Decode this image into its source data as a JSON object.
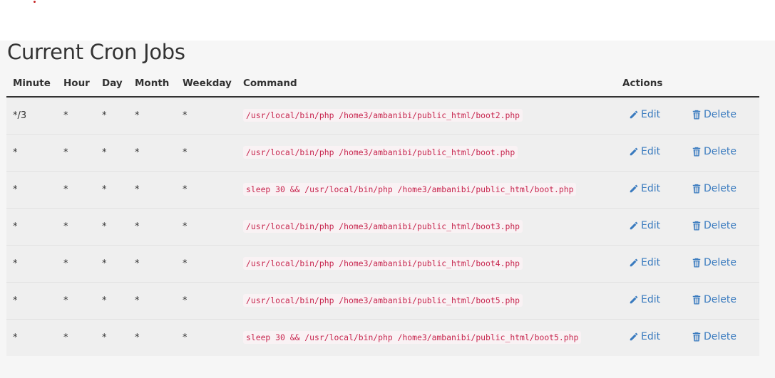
{
  "page": {
    "title": "Current Cron Jobs"
  },
  "table": {
    "headers": {
      "minute": "Minute",
      "hour": "Hour",
      "day": "Day",
      "month": "Month",
      "weekday": "Weekday",
      "command": "Command",
      "actions": "Actions"
    },
    "edit_label": "Edit",
    "delete_label": "Delete",
    "edit_icon": "pencil-icon",
    "delete_icon": "trash-icon",
    "rows": [
      {
        "minute": "*/3",
        "hour": "*",
        "day": "*",
        "month": "*",
        "weekday": "*",
        "command": "/usr/local/bin/php /home3/ambanibi/public_html/boot2.php"
      },
      {
        "minute": "*",
        "hour": "*",
        "day": "*",
        "month": "*",
        "weekday": "*",
        "command": "/usr/local/bin/php /home3/ambanibi/public_html/boot.php"
      },
      {
        "minute": "*",
        "hour": "*",
        "day": "*",
        "month": "*",
        "weekday": "*",
        "command": "sleep 30 && /usr/local/bin/php /home3/ambanibi/public_html/boot.php"
      },
      {
        "minute": "*",
        "hour": "*",
        "day": "*",
        "month": "*",
        "weekday": "*",
        "command": "/usr/local/bin/php /home3/ambanibi/public_html/boot3.php"
      },
      {
        "minute": "*",
        "hour": "*",
        "day": "*",
        "month": "*",
        "weekday": "*",
        "command": "/usr/local/bin/php /home3/ambanibi/public_html/boot4.php"
      },
      {
        "minute": "*",
        "hour": "*",
        "day": "*",
        "month": "*",
        "weekday": "*",
        "command": "/usr/local/bin/php /home3/ambanibi/public_html/boot5.php"
      },
      {
        "minute": "*",
        "hour": "*",
        "day": "*",
        "month": "*",
        "weekday": "*",
        "command": "sleep 30 && /usr/local/bin/php /home3/ambanibi/public_html/boot5.php"
      }
    ]
  },
  "colors": {
    "link": "#3a7bbf",
    "code_text": "#c7254e",
    "code_background": "#f9f2f4",
    "row_background": "#efefef"
  }
}
